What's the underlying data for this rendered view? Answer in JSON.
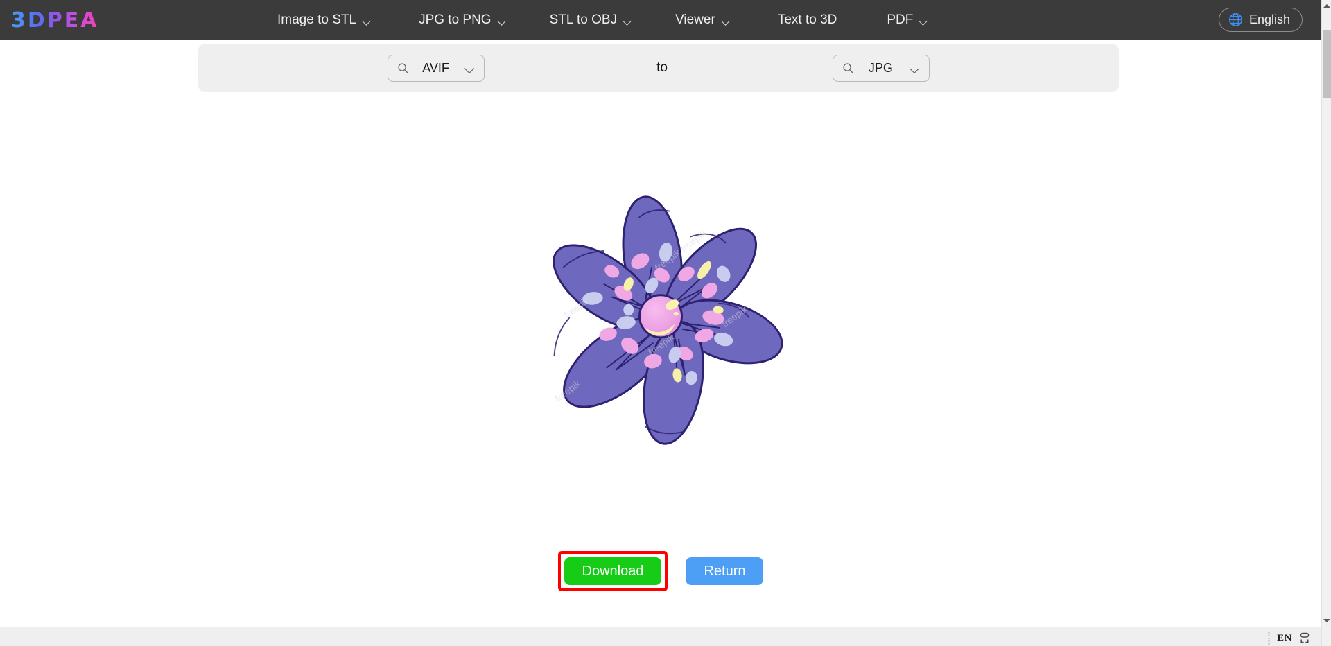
{
  "navbar": {
    "logo": "3DPEA",
    "items": [
      {
        "label": "Image to STL",
        "has_caret": true,
        "icon": "chevron-down-icon"
      },
      {
        "label": "JPG to PNG",
        "has_caret": true,
        "icon": "chevron-down-icon"
      },
      {
        "label": "STL to OBJ",
        "has_caret": true,
        "icon": "chevron-down-icon"
      },
      {
        "label": "Viewer",
        "has_caret": true,
        "icon": "chevron-down-icon"
      },
      {
        "label": "Text to 3D",
        "has_caret": false,
        "icon": ""
      },
      {
        "label": "PDF",
        "has_caret": true,
        "icon": "chevron-down-icon"
      }
    ],
    "language": {
      "label": "English",
      "icon": "globe-icon"
    },
    "background_color": "#3b3b3b"
  },
  "converter": {
    "source_format": {
      "value": "AVIF",
      "search_icon": "search-icon",
      "caret_icon": "chevron-down-icon"
    },
    "separator_label": "to",
    "target_format": {
      "value": "JPG",
      "search_icon": "search-icon",
      "caret_icon": "chevron-down-icon"
    },
    "bar_background": "#efefef"
  },
  "preview": {
    "image_alt": "purple five-petal flower illustration",
    "watermark": "freepik",
    "colors": {
      "petal": "#6f68bf",
      "petal_outline": "#2d2170",
      "spot_pink": "#f0a8e4",
      "spot_blue": "#c8cdf0",
      "spot_yellow": "#f7f0a8",
      "center_pink": "#efa3e6",
      "center_yellow": "#faf3b0",
      "background": "#ffffff"
    }
  },
  "actions": {
    "download": {
      "label": "Download",
      "color": "#16cc16",
      "highlighted": true,
      "highlight_color": "#ff0000"
    },
    "return": {
      "label": "Return",
      "color": "#4d9ef5"
    }
  },
  "scrollbar": {
    "up_arrow_icon": "triangle-up-icon",
    "down_arrow_icon": "triangle-down-icon",
    "thumb_color": "#c1c1c1"
  },
  "taskbar": {
    "ime_language": "EN",
    "ime_mode_icon": "ime-box-icon",
    "handle_icon": "drag-handle-icon"
  }
}
